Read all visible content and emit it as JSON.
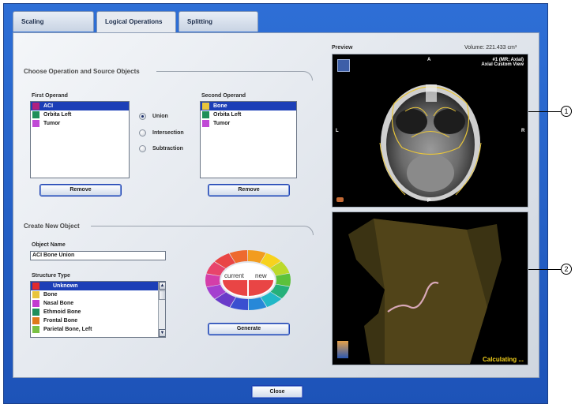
{
  "tabs": [
    {
      "label": "Scaling"
    },
    {
      "label": "Logical Operations"
    },
    {
      "label": "Splitting"
    }
  ],
  "operation": {
    "section_title": "Choose Operation and Source Objects",
    "first_operand_label": "First Operand",
    "second_operand_label": "Second Operand",
    "first_operand_items": [
      {
        "label": "ACI",
        "color": "#b0207e",
        "selected": true
      },
      {
        "label": "Orbita Left",
        "color": "#1f8f5a",
        "selected": false
      },
      {
        "label": "Tumor",
        "color": "#c04ad6",
        "selected": false
      }
    ],
    "second_operand_items": [
      {
        "label": "Bone",
        "color": "#e8c53a",
        "selected": true
      },
      {
        "label": "Orbita Left",
        "color": "#1f8f5a",
        "selected": false
      },
      {
        "label": "Tumor",
        "color": "#c04ad6",
        "selected": false
      }
    ],
    "operations": [
      {
        "label": "Union",
        "selected": true
      },
      {
        "label": "Intersection",
        "selected": false
      },
      {
        "label": "Subtraction",
        "selected": false
      }
    ],
    "remove_label": "Remove"
  },
  "create": {
    "section_title": "Create New Object",
    "object_name_label": "Object Name",
    "object_name_value": "ACI Bone Union",
    "structure_type_label": "Structure Type",
    "structure_types": [
      {
        "label": "Unknown",
        "color": "#e02b2b",
        "selected": true
      },
      {
        "label": "Bone",
        "color": "#e8c53a",
        "selected": false
      },
      {
        "label": "Nasal Bone",
        "color": "#c23ad0",
        "selected": false
      },
      {
        "label": "Ethmoid Bone",
        "color": "#1f8f5a",
        "selected": false
      },
      {
        "label": "Frontal Bone",
        "color": "#e07a1a",
        "selected": false
      },
      {
        "label": "Parietal Bone, Left",
        "color": "#7ac143",
        "selected": false
      }
    ],
    "color_wheel": {
      "current_label": "current",
      "new_label": "new",
      "current_color": "#e94545",
      "new_color": "#e94545",
      "ring_colors": [
        "#f29c1f",
        "#f7d21e",
        "#bcd92b",
        "#5cc13b",
        "#25b07a",
        "#22b8c7",
        "#2788d8",
        "#3a4fd0",
        "#6a3bc9",
        "#a43fcf",
        "#d43ea9",
        "#e8446b",
        "#e94545",
        "#ee6a2e"
      ]
    },
    "generate_label": "Generate"
  },
  "preview": {
    "label": "Preview",
    "volume_text": "Volume: 221.433 cm³",
    "axial": {
      "header_line1": "#1 (MR; Axial)",
      "header_line2": "Axial Custom View",
      "orient_top": "A",
      "orient_bottom": "P",
      "orient_left": "L",
      "orient_right": "R"
    },
    "render_status": "Calculating ..."
  },
  "callouts": [
    "1",
    "2"
  ],
  "footer": {
    "close_label": "Close"
  },
  "colors": {
    "accent": "#1c3fb7",
    "frame": "#2a66d0",
    "status_text": "#f5d21a"
  }
}
